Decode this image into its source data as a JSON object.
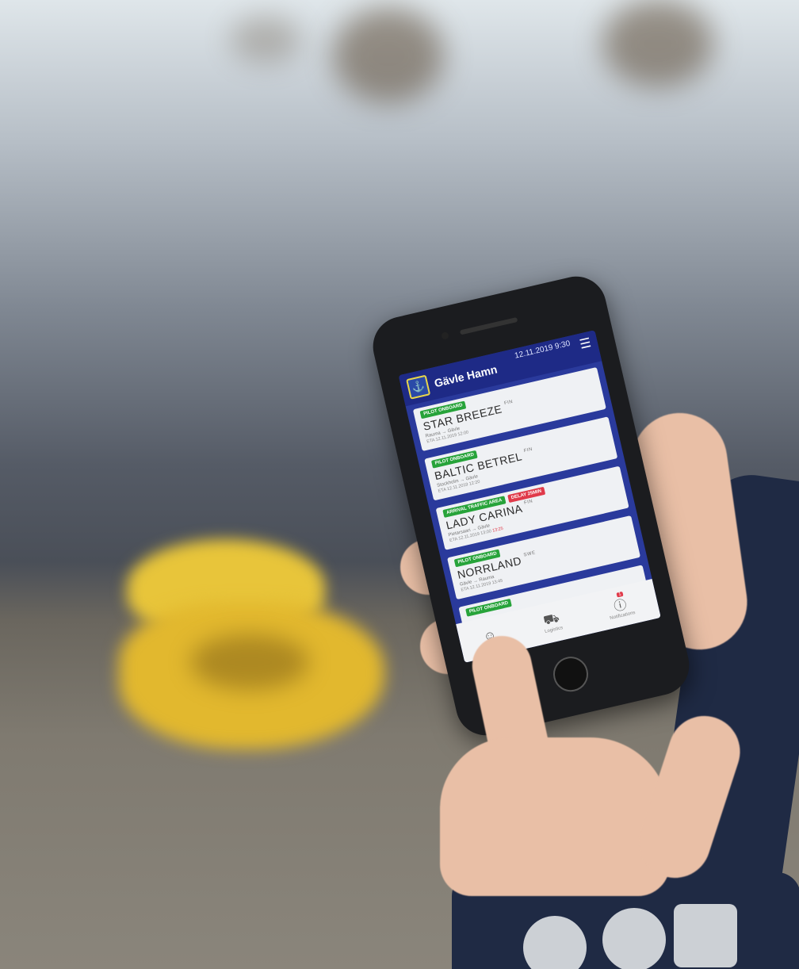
{
  "app": {
    "title": "Gävle Hamn",
    "datetime": "12.11.2019 9:30",
    "menu_icon": "hamburger-menu-icon",
    "logo_icon": "anchor-logo-icon"
  },
  "vessels": [
    {
      "status": [
        "PILOT ONBOARD"
      ],
      "name": "STAR BREEZE",
      "flag": "FIN",
      "from": "Rauma",
      "to": "Gävle",
      "eta": "ETA 12.11.2019 12:00",
      "late": ""
    },
    {
      "status": [
        "PILOT ONBOARD"
      ],
      "name": "BALTIC BETREL",
      "flag": "FIN",
      "from": "Stockholm",
      "to": "Gävle",
      "eta": "ETA 12.11.2019 12:20",
      "late": ""
    },
    {
      "status": [
        "ARRIVAL TRAFFIC AREA",
        "DELAY 25MIN"
      ],
      "name": "LADY CARINA",
      "flag": "FIN",
      "from": "Pietarsaari",
      "to": "Gävle",
      "eta": "ETA 12.11.2019 13:00",
      "late": "13:25"
    },
    {
      "status": [
        "PILOT ONBOARD"
      ],
      "name": "NORRLAND",
      "flag": "SWE",
      "from": "Gävle",
      "to": "Rauma",
      "eta": "ETA 12.11.2019 13:45",
      "late": ""
    },
    {
      "status": [
        "PILOT ONBOARD"
      ],
      "name": "",
      "flag": "",
      "from": "",
      "to": "",
      "eta": "",
      "late": ""
    }
  ],
  "tabs": [
    {
      "label": "",
      "icon": "person-icon"
    },
    {
      "label": "Logistics",
      "icon": "truck-icon"
    },
    {
      "label": "Notifications",
      "icon": "info-icon",
      "count": "1"
    }
  ],
  "colors": {
    "header": "#1e2a86",
    "screen_bg": "#2a3a9c",
    "badge_green": "#27a33a",
    "badge_red": "#e03a4a",
    "bollard_yellow": "#e2b82e"
  }
}
